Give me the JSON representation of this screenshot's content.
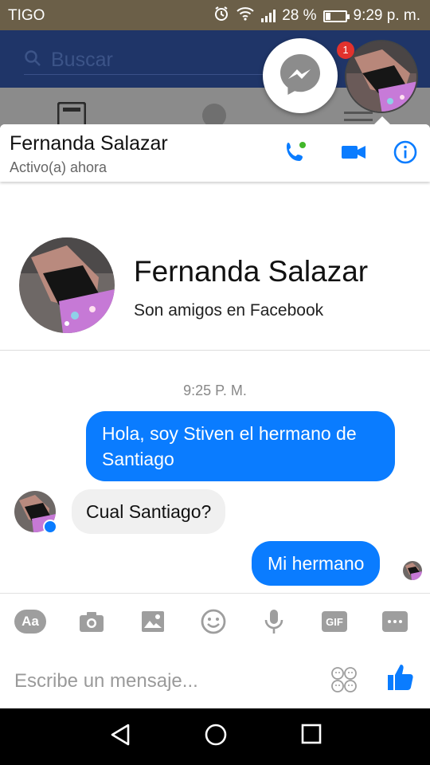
{
  "status_bar": {
    "carrier": "TIGO",
    "battery_percent": "28 %",
    "battery_level": 0.28,
    "time": "9:29 p. m."
  },
  "facebook_bg": {
    "search_placeholder": "Buscar",
    "notification_count": "1"
  },
  "conversation": {
    "contact_name": "Fernanda Salazar",
    "contact_status": "Activo(a) ahora",
    "profile_subtitle": "Son amigos en Facebook",
    "timestamp": "9:25 P. M.",
    "messages": [
      {
        "direction": "out",
        "text": "Hola, soy Stiven el hermano de Santiago"
      },
      {
        "direction": "in",
        "text": "Cual Santiago?"
      },
      {
        "direction": "out",
        "text": "Mi hermano"
      }
    ]
  },
  "toolbar": {
    "aa_label": "Aa",
    "gif_label": "GIF",
    "icons": [
      "aa-icon",
      "camera-icon",
      "image-icon",
      "emoji-icon",
      "microphone-icon",
      "gif-icon",
      "more-icon"
    ]
  },
  "composer": {
    "placeholder": "Escribe un mensaje..."
  },
  "colors": {
    "accent": "#0a7cff",
    "status_bar": "#6b5f48",
    "fb_header": "#1f3568"
  }
}
